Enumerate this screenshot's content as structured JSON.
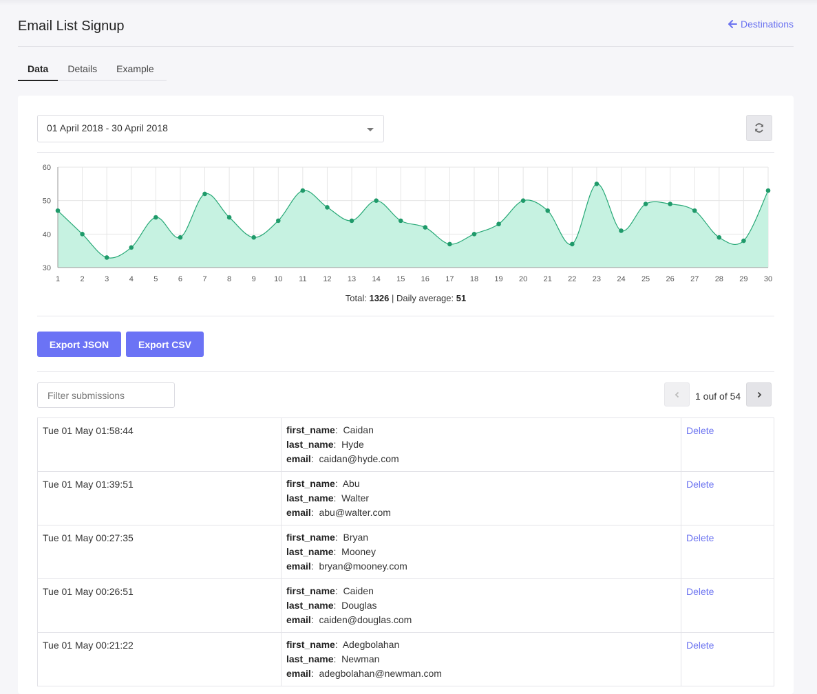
{
  "header": {
    "title": "Email List Signup",
    "back_link": "Destinations"
  },
  "tabs": [
    {
      "label": "Data",
      "active": true
    },
    {
      "label": "Details",
      "active": false
    },
    {
      "label": "Example",
      "active": false
    }
  ],
  "date_range": "01 April 2018 - 30 April 2018",
  "icons": {
    "refresh": "refresh-icon",
    "back": "arrow-left-icon"
  },
  "colors": {
    "accent": "#6b73f5",
    "series_fill": "#c6f2e1",
    "series_line": "#27a876",
    "series_point": "#1f9a6a"
  },
  "chart_data": {
    "type": "area",
    "x": [
      1,
      2,
      3,
      4,
      5,
      6,
      7,
      8,
      9,
      10,
      11,
      12,
      13,
      14,
      15,
      16,
      17,
      18,
      19,
      20,
      21,
      22,
      23,
      24,
      25,
      26,
      27,
      28,
      29,
      30
    ],
    "values": [
      47,
      40,
      33,
      36,
      45,
      39,
      52,
      45,
      39,
      44,
      53,
      48,
      44,
      50,
      44,
      42,
      37,
      40,
      43,
      50,
      47,
      37,
      55,
      41,
      49,
      49,
      47,
      39,
      38,
      53
    ],
    "ylim": [
      30,
      60
    ],
    "yticks": [
      30,
      40,
      50,
      60
    ],
    "grid": true,
    "smooth": true
  },
  "summary": {
    "total_label": "Total:",
    "total": "1326",
    "separator": "|",
    "avg_label": "Daily average:",
    "avg": "51"
  },
  "buttons": {
    "export_json": "Export JSON",
    "export_csv": "Export CSV"
  },
  "filter": {
    "placeholder": "Filter submissions"
  },
  "pagination": {
    "text": "1 ouf of 54"
  },
  "submissions": [
    {
      "time": "Tue 01 May 01:58:44",
      "first_name": "Caidan",
      "last_name": "Hyde",
      "email": "caidan@hyde.com",
      "action": "Delete"
    },
    {
      "time": "Tue 01 May 01:39:51",
      "first_name": "Abu",
      "last_name": "Walter",
      "email": "abu@walter.com",
      "action": "Delete"
    },
    {
      "time": "Tue 01 May 00:27:35",
      "first_name": "Bryan",
      "last_name": "Mooney",
      "email": "bryan@mooney.com",
      "action": "Delete"
    },
    {
      "time": "Tue 01 May 00:26:51",
      "first_name": "Caiden",
      "last_name": "Douglas",
      "email": "caiden@douglas.com",
      "action": "Delete"
    },
    {
      "time": "Tue 01 May 00:21:22",
      "first_name": "Adegbolahan",
      "last_name": "Newman",
      "email": "adegbolahan@newman.com",
      "action": "Delete"
    }
  ],
  "field_labels": {
    "first_name": "first_name",
    "last_name": "last_name",
    "email": "email"
  }
}
